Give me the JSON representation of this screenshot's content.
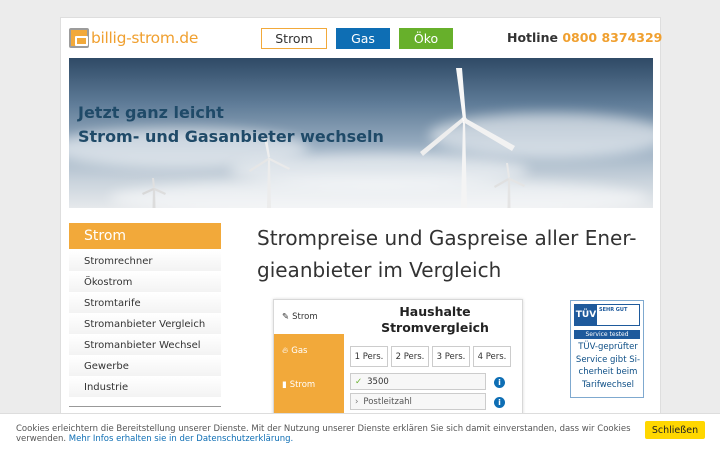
{
  "header": {
    "logo_text": "billig-strom.de",
    "nav": [
      {
        "label": "Strom",
        "color": "#ffffff"
      },
      {
        "label": "Gas",
        "color": "#0e6eb4"
      },
      {
        "label": "Öko",
        "color": "#67b02b"
      }
    ],
    "hotline_label": "Hotline",
    "hotline_number": "0800 8374329"
  },
  "hero": {
    "line1": "Jetzt ganz leicht",
    "line2": "Strom- und Gasanbieter wechseln"
  },
  "sidebar": {
    "heading": "Strom",
    "items": [
      "Stromrechner",
      "Ökostrom",
      "Stromtarife",
      "Stromanbieter Vergleich",
      "Stromanbieter Wechsel",
      "Gewerbe",
      "Industrie"
    ]
  },
  "main": {
    "title_line1": "Strompreise und Gaspreise aller Ener-",
    "title_line2": "gieanbieter im Vergleich"
  },
  "calculator": {
    "tabs": [
      "Strom",
      "Gas",
      "Strom"
    ],
    "title_line1": "Haushalte",
    "title_line2": "Stromvergleich",
    "persons": [
      "1 Pers.",
      "2 Pers.",
      "3 Pers.",
      "4 Pers."
    ],
    "consumption_value": "3500",
    "zip_placeholder": "Postleitzahl"
  },
  "badge": {
    "logo": "TÜV",
    "grade": "SEHR GUT",
    "band": "Service tested",
    "text_lines": [
      "TÜV-geprüfter",
      "Service gibt Si-",
      "cherheit beim",
      "Tarifwechsel"
    ]
  },
  "cookie": {
    "text": "Cookies erleichtern die Bereitstellung unserer Dienste. Mit der Nutzung unserer Dienste erklären Sie sich damit einverstanden, dass wir Cookies verwenden.",
    "link_text": "Mehr Infos erhalten sie in der Datenschutzerklärung.",
    "button": "Schließen"
  },
  "colors": {
    "accent_orange": "#f2a93a",
    "gas_blue": "#0e6eb4",
    "eco_green": "#67b02b"
  }
}
